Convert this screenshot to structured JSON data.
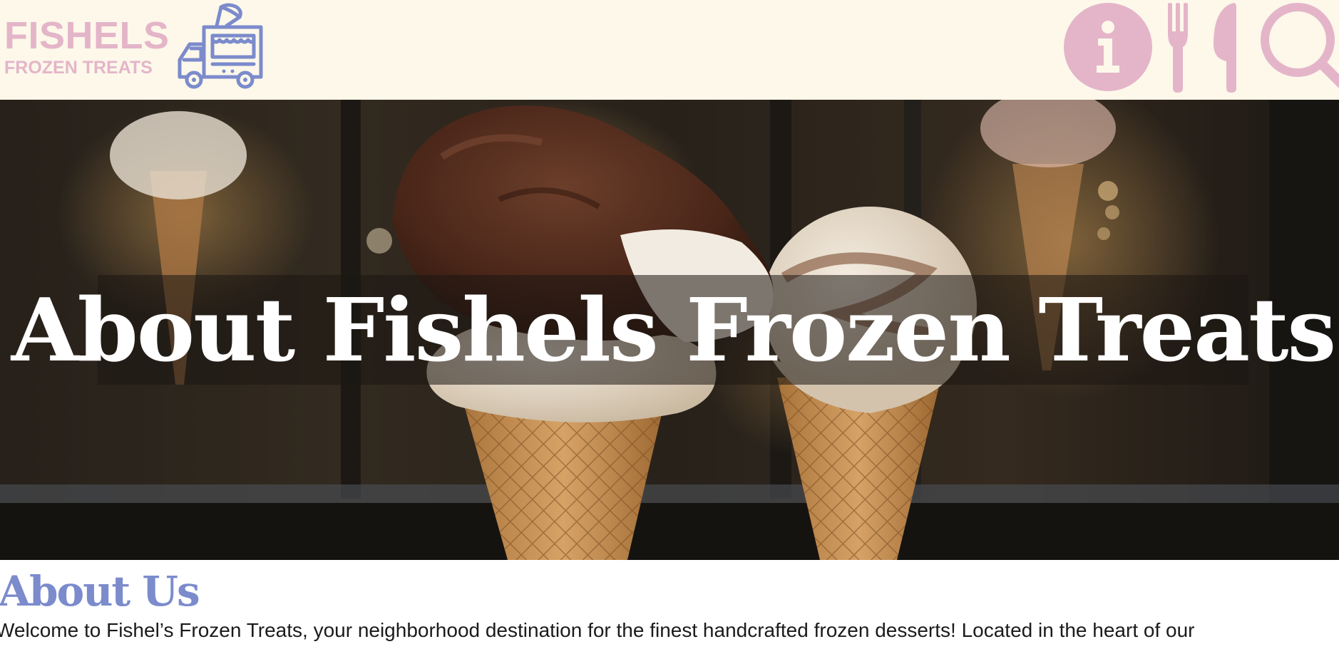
{
  "brand": {
    "line1": "FISHELS",
    "line2": "FROZEN TREATS",
    "logo_icon": "food-truck-icon",
    "text_color": "#e4b5c9",
    "truck_color": "#7b8bcc"
  },
  "nav": {
    "items": [
      {
        "icon": "info-icon"
      },
      {
        "icon": "fork-knife-icon"
      },
      {
        "icon": "search-icon"
      }
    ],
    "icon_color": "#e4b5c9"
  },
  "hero": {
    "title": "About Fishels Frozen Treats"
  },
  "about": {
    "heading": "About Us",
    "body": "Welcome to Fishel’s Frozen Treats, your neighborhood destination for the finest handcrafted frozen desserts! Located in the heart of our",
    "heading_color": "#7b8bcc"
  },
  "colors": {
    "header_bg": "#fdf8ea",
    "accent_pink": "#e4b5c9",
    "accent_blue": "#7b8bcc"
  }
}
